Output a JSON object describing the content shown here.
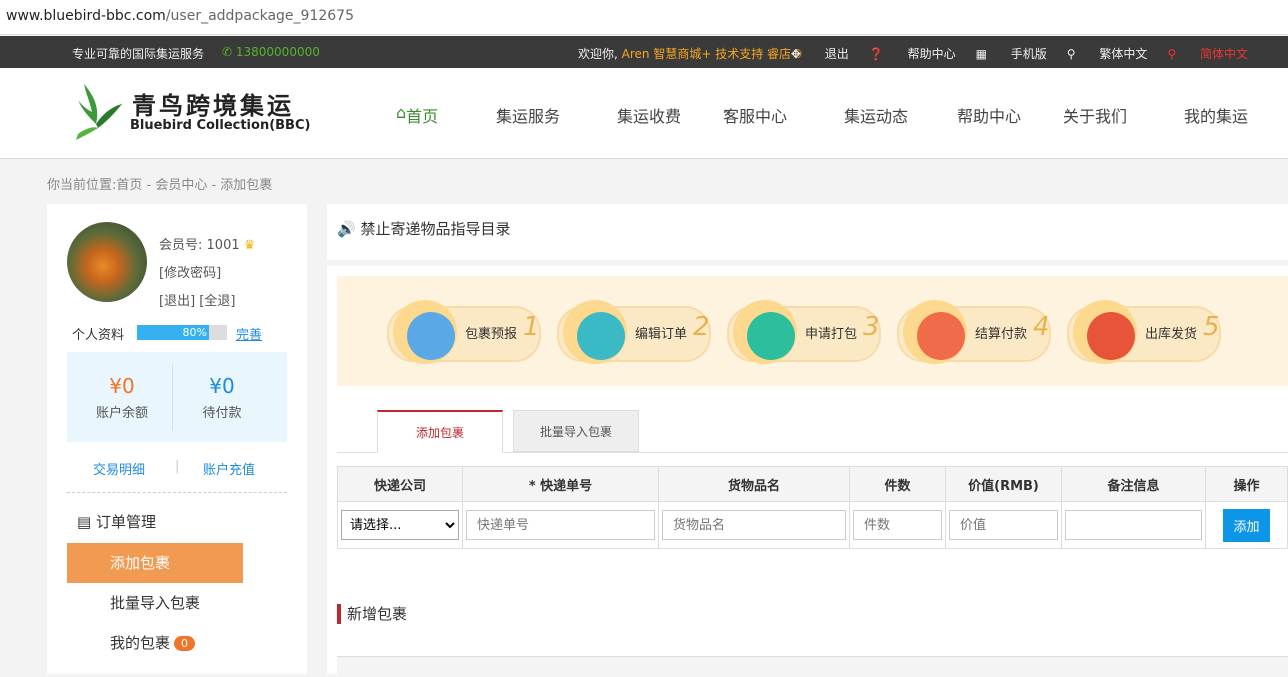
{
  "browser": {
    "url_host": "www.bluebird-bbc.com",
    "url_path": "/user_addpackage_912675"
  },
  "topbar": {
    "tagline": "专业可靠的国际集运服务",
    "phone": "13800000000",
    "welcome_prefix": "欢迎你,",
    "welcome_user": "Aren 智慧商城+ 技术支持 睿店®",
    "links": [
      "退出",
      "帮助中心",
      "手机版",
      "繁体中文",
      "简体中文"
    ]
  },
  "logo": {
    "cn": "青鸟跨境集运",
    "en": "Bluebird Collection(BBC)"
  },
  "nav": [
    "首页",
    "集运服务",
    "集运收费",
    "客服中心",
    "集运动态",
    "帮助中心",
    "关于我们",
    "我的集运"
  ],
  "breadcrumb": "你当前位置:首页 - 会员中心 - 添加包裹",
  "user": {
    "member_label": "会员号:",
    "member_id": "1001",
    "change_pwd": "[修改密码]",
    "logout": "[退出] [全退]",
    "profile_label": "个人资料",
    "profile_pct": "80%",
    "profile_fill": 0.8,
    "complete": "完善"
  },
  "balance": {
    "account_amount": "¥0",
    "account_label": "账户余额",
    "pending_amount": "¥0",
    "pending_label": "待付款"
  },
  "links": {
    "transactions": "交易明细",
    "recharge": "账户充值"
  },
  "menu": {
    "head": "订单管理",
    "items": [
      "添加包裹",
      "批量导入包裹",
      "我的包裹"
    ],
    "badge": "0"
  },
  "notice": "禁止寄递物品指导目录",
  "steps": [
    {
      "label": "包裹预报",
      "num": "1"
    },
    {
      "label": "编辑订单",
      "num": "2"
    },
    {
      "label": "申请打包",
      "num": "3"
    },
    {
      "label": "结算付款",
      "num": "4"
    },
    {
      "label": "出库发货",
      "num": "5"
    }
  ],
  "tabs": [
    "添加包裹",
    "批量导入包裹"
  ],
  "table": {
    "headers": [
      "快递公司",
      "* 快递单号",
      "货物品名",
      "件数",
      "价值(RMB)",
      "备注信息",
      "操作"
    ],
    "select_value": "请选择...",
    "placeholders": [
      "快递单号",
      "货物品名",
      "件数",
      "价值",
      ""
    ],
    "add_label": "添加"
  },
  "section": "新增包裹",
  "colors": {
    "accent_green": "#3c8d2f",
    "menu_active": "#f19a51",
    "primary_blue": "#0d95e8",
    "red": "#c0272d"
  }
}
